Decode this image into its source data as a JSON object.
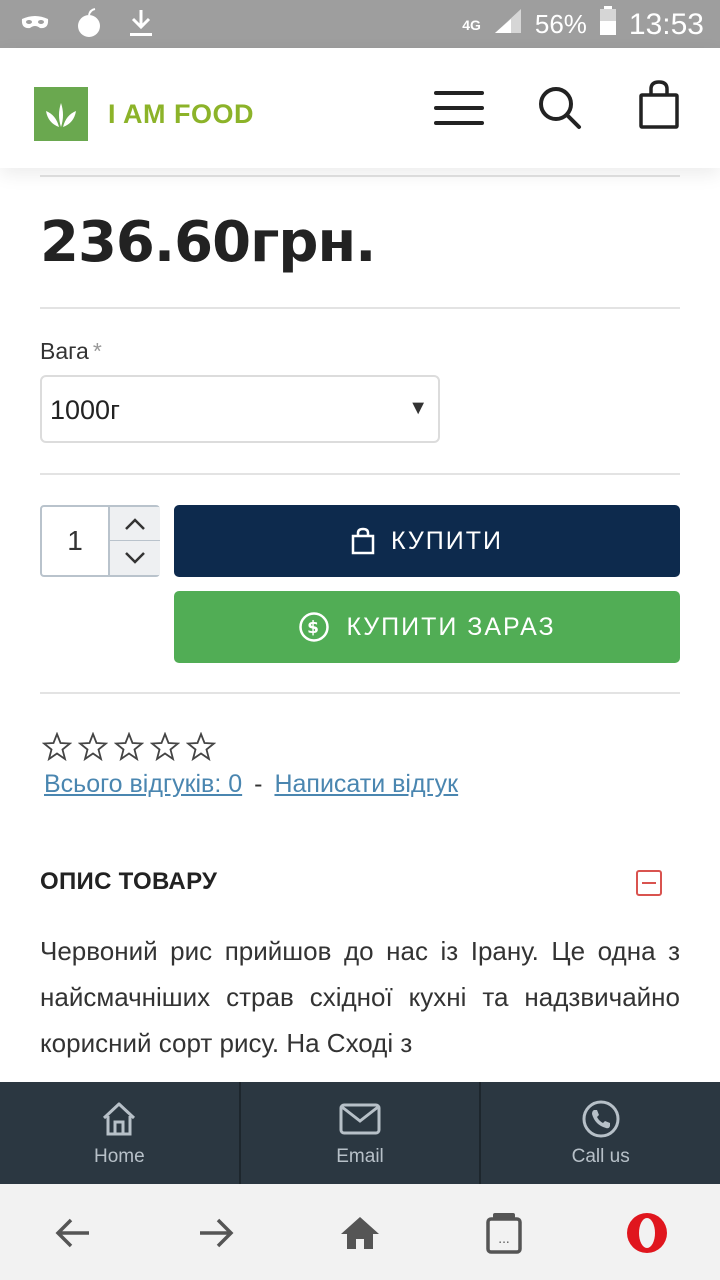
{
  "status_bar": {
    "network": "4G",
    "battery_percent": "56%",
    "time": "13:53"
  },
  "header": {
    "logo_text": "I AM FOOD"
  },
  "product": {
    "price": "236.60грн.",
    "weight_label": "Вага",
    "required_mark": "*",
    "weight_selected": "1000г",
    "quantity": "1",
    "buy_label": "КУПИТИ",
    "buy_now_label": "КУПИТИ ЗАРАЗ"
  },
  "reviews": {
    "rating": 0,
    "max_rating": 5,
    "total_label": "Всього відгуків: 0",
    "separator": "-",
    "write_label": "Написати відгук"
  },
  "description": {
    "title": "ОПИС ТОВАРУ",
    "text": "Червоний рис прийшов до нас із Ірану. Це одна з найсмачніших страв східної кухні та надзвичайно корисний сорт рису. На Сході з"
  },
  "contact_bar": {
    "items": [
      {
        "label": "Home",
        "icon": "home-icon"
      },
      {
        "label": "Email",
        "icon": "email-icon"
      },
      {
        "label": "Call us",
        "icon": "phone-icon"
      }
    ]
  },
  "colors": {
    "primary_button": "#0d2a4d",
    "buy_now_button": "#51ad55",
    "logo_green": "#6aa84f",
    "link": "#4a86b0",
    "collapse": "#d9534f",
    "contact_bar": "#2b3741"
  }
}
